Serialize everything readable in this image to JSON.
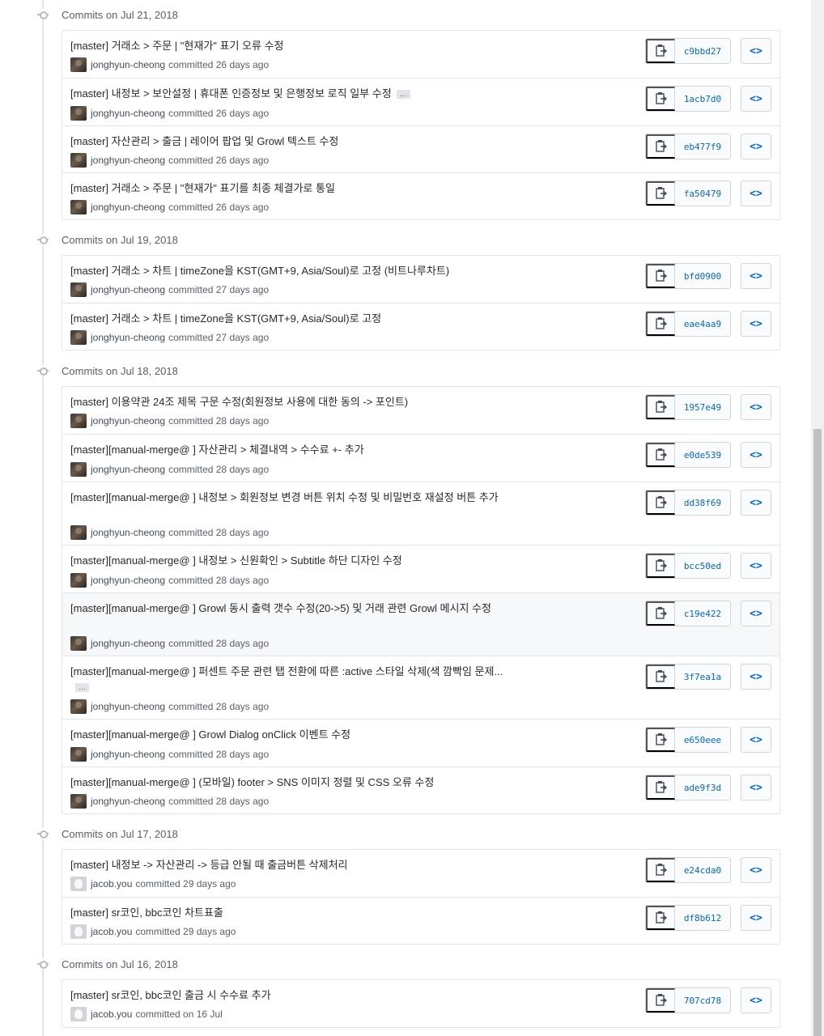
{
  "groups": [
    {
      "date": "Commits on Jul 21, 2018",
      "commits": [
        {
          "message": "[master] 거래소 > 주문 | \"현재가\" 표기 오류 수정",
          "author": "jonghyun-cheong",
          "time": "committed 26 days ago",
          "sha": "c9bbd27"
        },
        {
          "message": "[master] 내정보 > 보안설정 | 휴대폰 인증정보 및 은행정보 로직 일부 수정",
          "more": "…",
          "author": "jonghyun-cheong",
          "time": "committed 26 days ago",
          "sha": "1acb7d0"
        },
        {
          "message": "[master] 자산관리 > 출금 | 레이어 팝업 및 Growl 텍스트 수정",
          "author": "jonghyun-cheong",
          "time": "committed 26 days ago",
          "sha": "eb477f9"
        },
        {
          "message": "[master] 거래소 > 주문 | \"현재가\" 표기를 최종 체결가로 통일",
          "author": "jonghyun-cheong",
          "time": "committed 26 days ago",
          "sha": "fa50479"
        }
      ]
    },
    {
      "date": "Commits on Jul 19, 2018",
      "commits": [
        {
          "message": "[master] 거래소 > 차트 | timeZone을 KST(GMT+9, Asia/Soul)로 고정 (비트나루차트)",
          "author": "jonghyun-cheong",
          "time": "committed 27 days ago",
          "sha": "bfd0900"
        },
        {
          "message": "[master] 거래소 > 차트 | timeZone을 KST(GMT+9, Asia/Soul)로 고정",
          "author": "jonghyun-cheong",
          "time": "committed 27 days ago",
          "sha": "eae4aa9"
        }
      ]
    },
    {
      "date": "Commits on Jul 18, 2018",
      "commits": [
        {
          "message": "[master] 이용약관 24조 제목 구문 수정(회원정보 사용에 대한 동의 -> 포인트)",
          "author": "jonghyun-cheong",
          "time": "committed 28 days ago",
          "sha": "1957e49"
        },
        {
          "message": "[master][manual-merge@           ] 자산관리 > 체결내역 > 수수료 +- 추가",
          "author": "jonghyun-cheong",
          "time": "committed 28 days ago",
          "sha": "e0de539"
        },
        {
          "message": "[master][manual-merge@           ] 내정보 > 회원정보 변경 버튼 위치 수정 및 비밀번호 재설정 버튼 추가",
          "author": "jonghyun-cheong",
          "time": "committed 28 days ago",
          "sha": "dd38f69"
        },
        {
          "message": "[master][manual-merge@           ] 내정보 > 신원확인 > Subtitle 하단 디자인 수정",
          "author": "jonghyun-cheong",
          "time": "committed 28 days ago",
          "sha": "bcc50ed"
        },
        {
          "message": "[master][manual-merge@           ] Growl 동시 출력 갯수 수정(20->5) 및 거래 관련 Growl 메시지 수정",
          "author": "jonghyun-cheong",
          "time": "committed 28 days ago",
          "sha": "c19e422",
          "highlight": true
        },
        {
          "message": "[master][manual-merge@           ] 퍼센트 주문 관련 탭 전환에 따른 :active 스타일 삭제(색 깜빡임 문제...",
          "more": "…",
          "author": "jonghyun-cheong",
          "time": "committed 28 days ago",
          "sha": "3f7ea1a"
        },
        {
          "message": "[master][manual-merge@           ] Growl Dialog onClick 이벤트 수정",
          "author": "jonghyun-cheong",
          "time": "committed 28 days ago",
          "sha": "e650eee"
        },
        {
          "message": "[master][manual-merge@           ] (모바일) footer > SNS 이미지 정렬 및 CSS 오류 수정",
          "author": "jonghyun-cheong",
          "time": "committed 28 days ago",
          "sha": "ade9f3d"
        }
      ]
    },
    {
      "date": "Commits on Jul 17, 2018",
      "commits": [
        {
          "message": "[master] 내정보 -> 자산관리 -> 등급 안될 때 출금버튼 삭제처리",
          "author": "jacob.you",
          "time": "committed 29 days ago",
          "sha": "e24cda0",
          "default_avatar": true
        },
        {
          "message": "[master] sr코인, bbc코인 차트표출",
          "author": "jacob.you",
          "time": "committed 29 days ago",
          "sha": "df8b612",
          "default_avatar": true
        }
      ]
    },
    {
      "date": "Commits on Jul 16, 2018",
      "commits": [
        {
          "message": "[master] sr코인, bbc코인 출금 시 수수료 추가",
          "author": "jacob.you",
          "time": "committed on 16 Jul",
          "sha": "707cd78",
          "default_avatar": true
        }
      ]
    }
  ],
  "icons": {
    "copy": "clipboard-icon",
    "browse": "code-icon",
    "commit": "git-commit-icon",
    "more": "ellipsis-icon"
  },
  "colors": {
    "link": "#0366d6",
    "border": "#e1e4e8",
    "muted": "#586069",
    "highlight_row": "#f6f8fa"
  }
}
